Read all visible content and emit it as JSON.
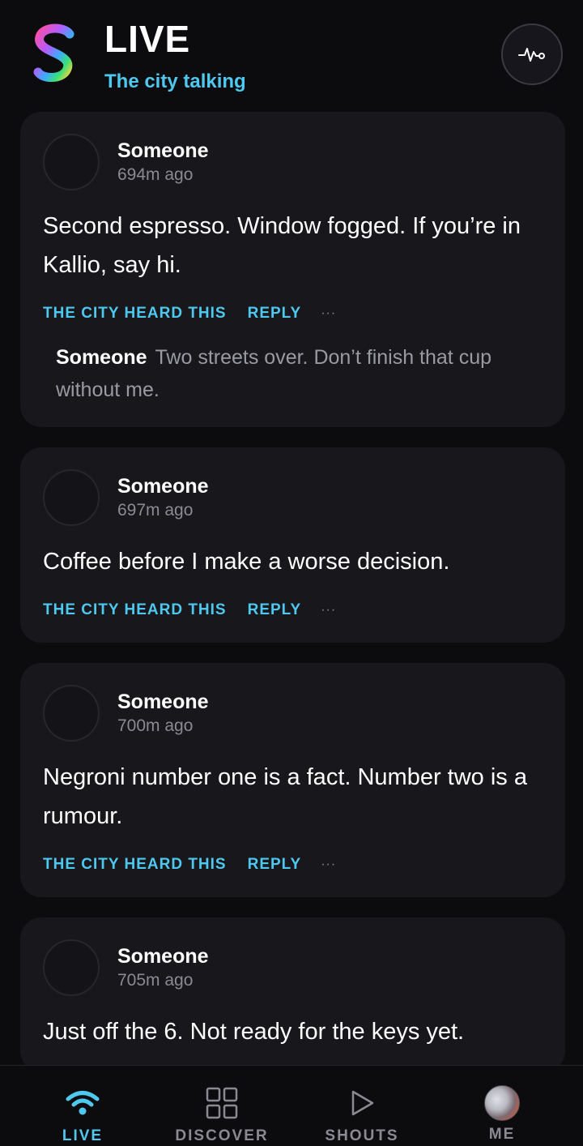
{
  "header": {
    "title": "LIVE",
    "subtitle": "The city talking",
    "logo_icon": "s-logo-icon",
    "action_icon": "pulse-icon"
  },
  "colors": {
    "accent": "#4fc8ef",
    "background": "#0c0c0f",
    "card": "#17171c",
    "muted": "#8a8a94"
  },
  "posts": [
    {
      "author": "Someone",
      "time": "694m ago",
      "text": "Second espresso. Window fogged. If you’re in Kallio, say hi.",
      "heard_label": "THE CITY HEARD THIS",
      "reply_label": "REPLY",
      "more_label": "···",
      "reply": {
        "author": "Someone",
        "text": "Two streets over. Don’t finish that cup without me."
      }
    },
    {
      "author": "Someone",
      "time": "697m ago",
      "text": "Coffee before I make a worse decision.",
      "heard_label": "THE CITY HEARD THIS",
      "reply_label": "REPLY",
      "more_label": "···"
    },
    {
      "author": "Someone",
      "time": "700m ago",
      "text": "Negroni number one is a fact. Number two is a rumour.",
      "heard_label": "THE CITY HEARD THIS",
      "reply_label": "REPLY",
      "more_label": "···"
    },
    {
      "author": "Someone",
      "time": "705m ago",
      "text": "Just off the 6. Not ready for the keys yet."
    }
  ],
  "nav": {
    "items": [
      {
        "label": "LIVE",
        "icon": "wifi-icon",
        "active": true
      },
      {
        "label": "DISCOVER",
        "icon": "grid-icon",
        "active": false
      },
      {
        "label": "SHOUTS",
        "icon": "play-icon",
        "active": false
      },
      {
        "label": "ME",
        "icon": "avatar-icon",
        "active": false
      }
    ]
  }
}
